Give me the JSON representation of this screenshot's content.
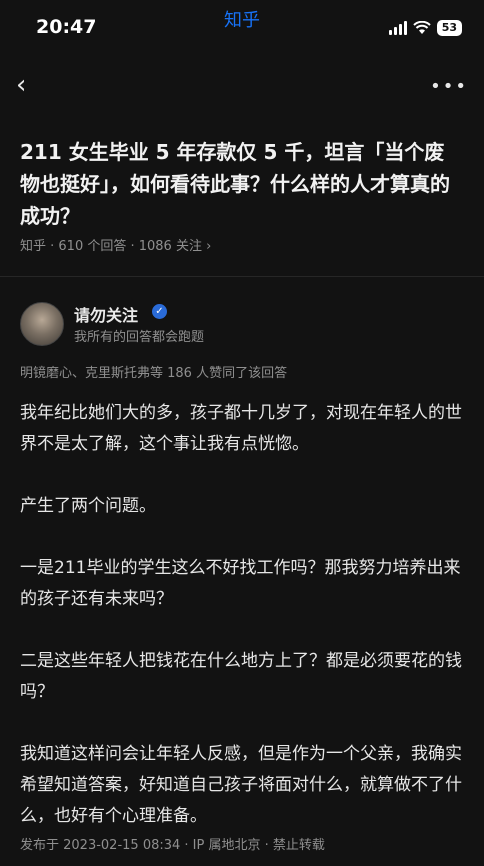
{
  "status": {
    "time": "20:47",
    "app": "知乎",
    "battery": "53"
  },
  "question": {
    "title": "211 女生毕业 5 年存款仅 5 千，坦言「当个废物也挺好」，如何看待此事？什么样的人才算真的成功？",
    "meta": "知乎 · 610 个回答 · 1086 关注 ›"
  },
  "author": {
    "name": "请勿关注",
    "bio": "我所有的回答都会跑题"
  },
  "endorse": "明镜磨心、克里斯托弗等 186 人赞同了该回答",
  "answer": {
    "paragraphs": [
      "我年纪比她们大的多，孩子都十几岁了，对现在年轻人的世界不是太了解，这个事让我有点恍惚。",
      "产生了两个问题。",
      "一是211毕业的学生这么不好找工作吗？那我努力培养出来的孩子还有未来吗？",
      "二是这些年轻人把钱花在什么地方上了？都是必须要花的钱吗？",
      "我知道这样问会让年轻人反感，但是作为一个父亲，我确实希望知道答案，好知道自己孩子将面对什么，就算做不了什么，也好有个心理准备。"
    ]
  },
  "footer": "发布于 2023-02-15 08:34 · IP 属地北京 · 禁止转载",
  "icons": {
    "back": "back-arrow-icon",
    "more": "more-icon",
    "badge": "verified-badge-icon",
    "signal": "signal-icon",
    "wifi": "wifi-icon",
    "battery": "battery-icon"
  },
  "colors": {
    "brand": "#1772f6",
    "background": "#121212"
  }
}
